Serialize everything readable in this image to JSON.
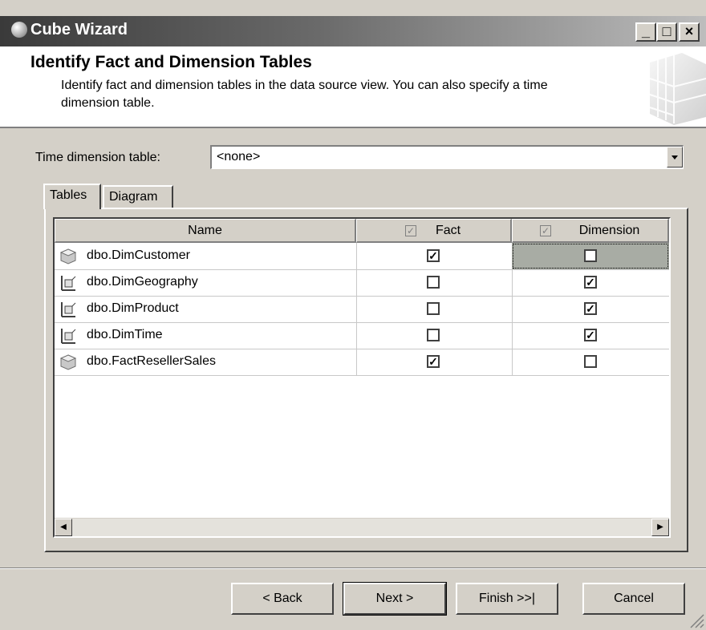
{
  "window": {
    "title": "Cube Wizard",
    "icon": "cube-icon",
    "controls": [
      "minimize",
      "maximize",
      "close"
    ]
  },
  "header": {
    "title": "Identify Fact and Dimension Tables",
    "description": "Identify fact and dimension tables in the data source view. You can also specify a time dimension table.",
    "image": "cube-graphic"
  },
  "time_dimension": {
    "label": "Time dimension table:",
    "value": "<none>"
  },
  "tabs": [
    {
      "label": "Tables",
      "active": true
    },
    {
      "label": "Diagram",
      "active": false
    }
  ],
  "grid": {
    "columns": {
      "name": "Name",
      "fact": "Fact",
      "dimension": "Dimension"
    },
    "rows": [
      {
        "name": "dbo.DimCustomer",
        "icon": "table-icon",
        "fact": true,
        "dimension": false,
        "selected": true
      },
      {
        "name": "dbo.DimGeography",
        "icon": "dimension-icon",
        "fact": false,
        "dimension": true,
        "selected": false
      },
      {
        "name": "dbo.DimProduct",
        "icon": "dimension-icon",
        "fact": false,
        "dimension": true,
        "selected": false
      },
      {
        "name": "dbo.DimTime",
        "icon": "dimension-icon",
        "fact": false,
        "dimension": true,
        "selected": false
      },
      {
        "name": "dbo.FactResellerSales",
        "icon": "table-icon",
        "fact": true,
        "dimension": false,
        "selected": false
      }
    ]
  },
  "buttons": {
    "back": "< Back",
    "next": "Next >",
    "finish": "Finish >>|",
    "cancel": "Cancel"
  }
}
